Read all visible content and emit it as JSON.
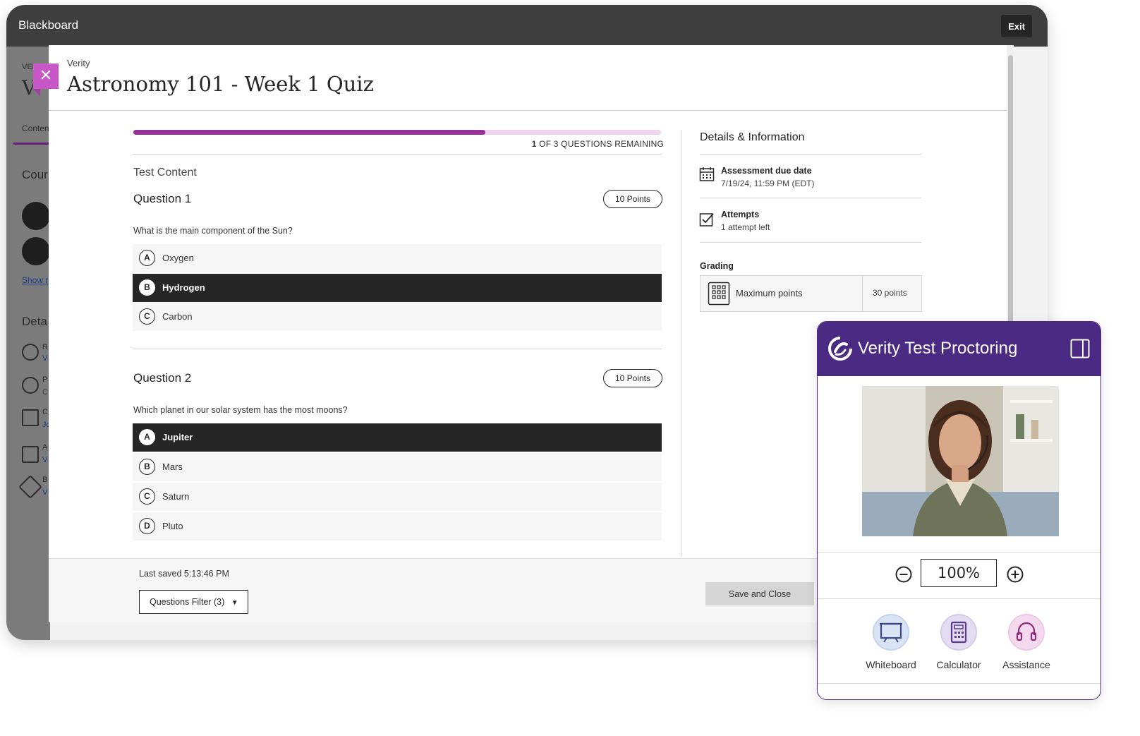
{
  "app": {
    "brand": "Blackboard",
    "exit_label": "Exit"
  },
  "background_page": {
    "texts": [
      "VERO",
      "V",
      "Conten",
      "Cour",
      "Show r",
      "Deta",
      "R",
      "V",
      "P",
      "C",
      "C",
      "Jo",
      "A",
      "V",
      "B",
      "V"
    ]
  },
  "quiz": {
    "breadcrumb": "Verity",
    "title": "Astronomy 101 - Week 1 Quiz",
    "progress_fraction": 0.667,
    "remaining_count": "1",
    "remaining_text": " OF 3 QUESTIONS REMAINING",
    "section_label": "Test Content",
    "questions": [
      {
        "heading": "Question 1",
        "points": "10 Points",
        "text": "What is the main component of the Sun?",
        "options": [
          {
            "letter": "A",
            "label": "Oxygen",
            "selected": false
          },
          {
            "letter": "B",
            "label": "Hydrogen",
            "selected": true
          },
          {
            "letter": "C",
            "label": "Carbon",
            "selected": false
          }
        ]
      },
      {
        "heading": "Question 2",
        "points": "10 Points",
        "text": "Which planet in our solar system has the most moons?",
        "options": [
          {
            "letter": "A",
            "label": "Jupiter",
            "selected": true
          },
          {
            "letter": "B",
            "label": "Mars",
            "selected": false
          },
          {
            "letter": "C",
            "label": "Saturn",
            "selected": false
          },
          {
            "letter": "D",
            "label": "Pluto",
            "selected": false
          }
        ]
      }
    ]
  },
  "details": {
    "title": "Details & Information",
    "due_label": "Assessment due date",
    "due_value": "7/19/24, 11:59 PM (EDT)",
    "attempts_label": "Attempts",
    "attempts_value": "1 attempt left",
    "grading_label": "Grading",
    "grading_name": "Maximum points",
    "grading_value": "30 points"
  },
  "footer": {
    "last_saved": "Last saved 5:13:46 PM",
    "filter_label": "Questions Filter (3)",
    "save_label": "Save and Close"
  },
  "proctor": {
    "title": "Verity Test Proctoring",
    "zoom_value": "100%",
    "tools": [
      "Whiteboard",
      "Calculator",
      "Assistance"
    ],
    "colors": {
      "header": "#4a2a82",
      "accent": "#96309b"
    }
  },
  "icons": [
    "close-icon",
    "calendar-icon",
    "checkbox-icon",
    "grid-calculator-icon",
    "verity-logo-icon",
    "sidebar-toggle-icon",
    "zoom-out-icon",
    "zoom-in-icon",
    "whiteboard-icon",
    "calculator-icon",
    "headset-icon",
    "caret-down-icon"
  ]
}
